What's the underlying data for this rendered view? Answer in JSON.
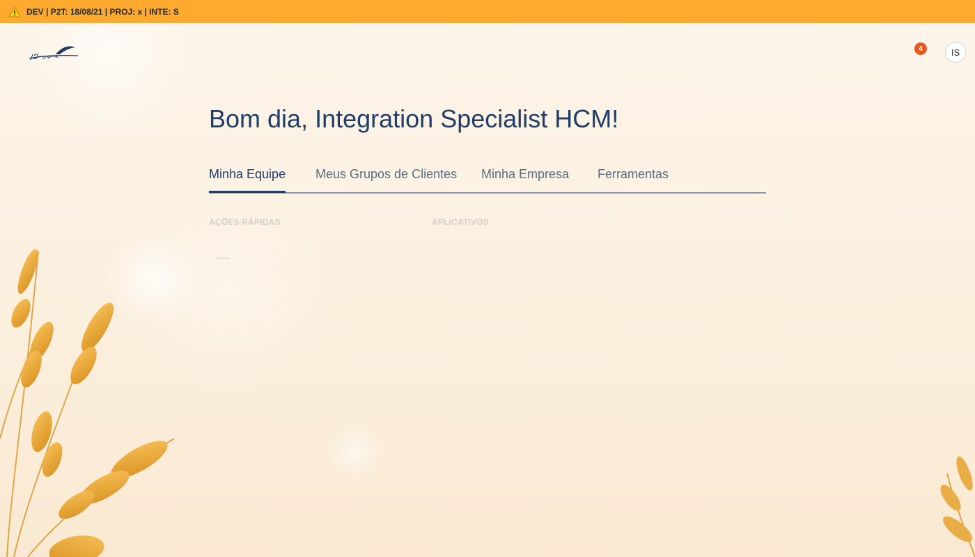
{
  "banner": {
    "text": "DEV | P2T: 18/08/21 | PROJ: x | INTE: S",
    "icon": "warning-icon",
    "color": "#ffa92e"
  },
  "header": {
    "logo_icon": "company-logo",
    "notifications": {
      "icon": "bell-icon",
      "count": "4",
      "badge_color": "#e9571e"
    },
    "avatar": {
      "initials": "IS"
    }
  },
  "main": {
    "greeting": "Bom dia, Integration Specialist HCM!",
    "tabs": [
      {
        "label": "Minha Equipe",
        "active": true
      },
      {
        "label": "Meus Grupos de Clientes",
        "active": false
      },
      {
        "label": "Minha Empresa",
        "active": false
      },
      {
        "label": "Ferramentas",
        "active": false
      }
    ],
    "sections": {
      "quick_actions": "AÇÕES RÁPIDAS",
      "apps": "APLICATIVOS"
    }
  },
  "colors": {
    "primary_text": "#1f3d66",
    "background": "#fcf5ea"
  }
}
